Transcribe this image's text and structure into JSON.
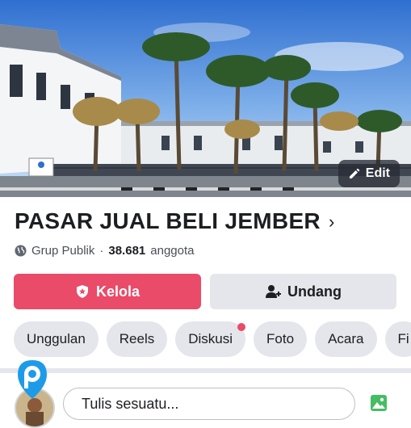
{
  "cover": {
    "edit_label": "Edit"
  },
  "group": {
    "title": "PASAR JUAL BELI JEMBER",
    "privacy": "Grup Publik",
    "separator": "·",
    "member_count": "38.681",
    "member_label": "anggota"
  },
  "actions": {
    "manage_label": "Kelola",
    "invite_label": "Undang"
  },
  "tabs": [
    {
      "label": "Unggulan"
    },
    {
      "label": "Reels"
    },
    {
      "label": "Diskusi"
    },
    {
      "label": "Foto"
    },
    {
      "label": "Acara"
    },
    {
      "label": "Fi"
    }
  ],
  "composer": {
    "placeholder": "Tulis sesuatu..."
  },
  "colors": {
    "accent": "#e94b68",
    "chip_bg": "#e4e6eb",
    "overlay_badge": "#1e9be8"
  }
}
